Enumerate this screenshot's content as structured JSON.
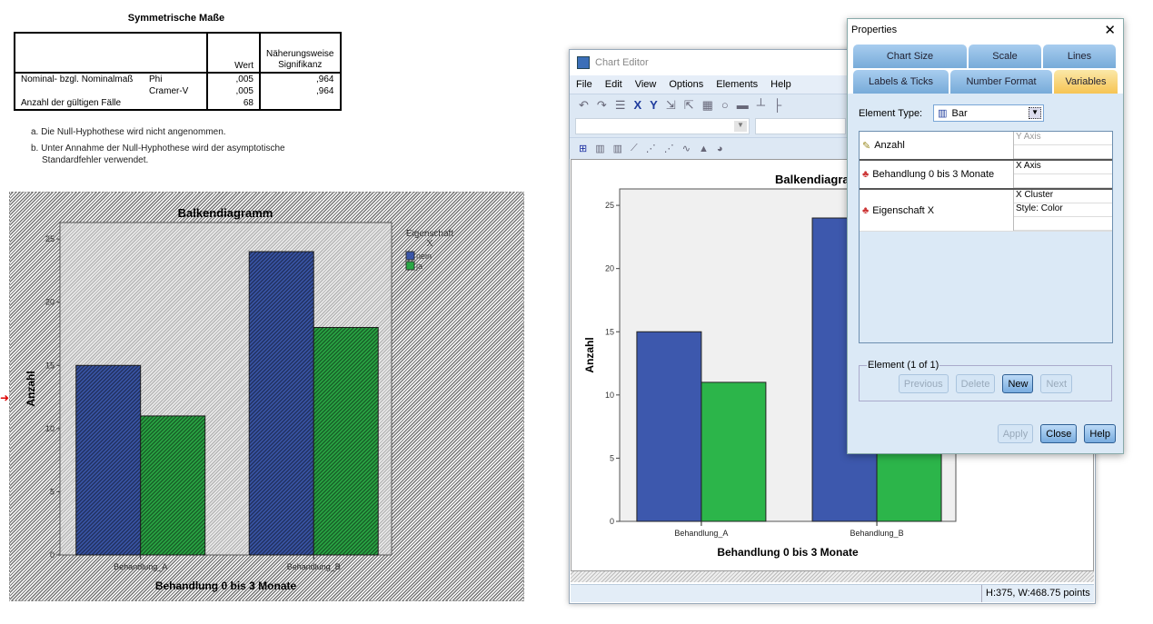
{
  "output": {
    "table_title": "Symmetrische Maße",
    "headers": {
      "value": "Wert",
      "sig": "Näherungsweise Signifikanz"
    },
    "group_label": "Nominal- bzgl. Nominalmaß",
    "rows": [
      {
        "label": "Phi",
        "value": ",005",
        "sig": ",964"
      },
      {
        "label": "Cramer-V",
        "value": ",005",
        "sig": ",964"
      }
    ],
    "n_label": "Anzahl der gültigen Fälle",
    "n_value": "68",
    "footnote_a": "a. Die Null-Hyphothese wird nicht angenommen.",
    "footnote_b1": "b. Unter Annahme der Null-Hyphothese wird der asymptotische",
    "footnote_b2": "Standardfehler verwendet."
  },
  "chart_data": [
    {
      "type": "bar",
      "title": "Balkendiagramm",
      "xlabel": "Behandlung 0 bis 3 Monate",
      "ylabel": "Anzahl",
      "categories": [
        "Behandlung_A",
        "Behandlung_B"
      ],
      "series": [
        {
          "name": "nein",
          "values": [
            15,
            24
          ],
          "color": "#3a56a8"
        },
        {
          "name": "ja",
          "values": [
            11,
            18
          ],
          "color": "#2aa845"
        }
      ],
      "legend_title": "Eigenschaft X",
      "legend_position": "right",
      "yticks": [
        0,
        5,
        10,
        15,
        20,
        25
      ],
      "ylim": [
        0,
        26.3
      ],
      "background": "hatched"
    },
    {
      "type": "bar",
      "title": "Balkendiagramm",
      "xlabel": "Behandlung 0 bis 3 Monate",
      "ylabel": "Anzahl",
      "categories": [
        "Behandlung_A",
        "Behandlung_B"
      ],
      "series": [
        {
          "values": [
            15,
            24
          ],
          "color": "#3d58ad"
        },
        {
          "values": [
            11,
            18
          ],
          "color": "#2cb54a"
        }
      ],
      "yticks": [
        0,
        5,
        10,
        15,
        20,
        25
      ],
      "ylim": [
        0,
        26.3
      ]
    }
  ],
  "editor": {
    "title": "Chart Editor",
    "menu": [
      "File",
      "Edit",
      "View",
      "Options",
      "Elements",
      "Help"
    ],
    "status": "H:375, W:468.75 points"
  },
  "properties": {
    "title": "Properties",
    "tabs_row1": [
      "Chart Size",
      "Scale",
      "Lines"
    ],
    "tabs_row2": [
      "Labels & Ticks",
      "Number Format",
      "Variables"
    ],
    "active_tab": "Variables",
    "element_type_label": "Element Type:",
    "element_type_value": "Bar",
    "variables": [
      {
        "name": "Anzahl",
        "roles": [
          "Y Axis",
          ""
        ]
      },
      {
        "name": "Behandlung 0 bis 3 Monate",
        "roles": [
          "X Axis",
          ""
        ]
      },
      {
        "name": "Eigenschaft X",
        "roles": [
          "X Cluster",
          "Style: Color",
          ""
        ]
      }
    ],
    "element_group": "Element (1 of 1)",
    "buttons": {
      "previous": "Previous",
      "delete": "Delete",
      "new": "New",
      "next": "Next",
      "apply": "Apply",
      "close": "Close",
      "help": "Help"
    }
  }
}
